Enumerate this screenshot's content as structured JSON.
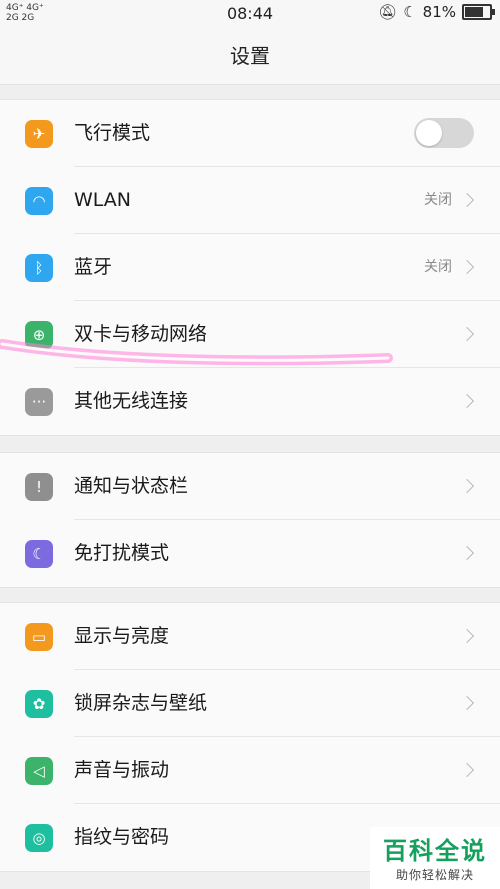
{
  "status_bar": {
    "signal_line1": "4G⁺ 4G⁺",
    "signal_line2": "2G  2G",
    "time": "08:44",
    "battery": "81%",
    "battery_level": 0.81
  },
  "header": {
    "title": "设置"
  },
  "groups": [
    {
      "items": [
        {
          "label": "飞行模式",
          "icon": "airplane-icon",
          "icon_color": "#f39a1e",
          "control": "toggle",
          "toggle_on": false
        },
        {
          "label": "WLAN",
          "icon": "wifi-icon",
          "icon_color": "#2ea7f0",
          "value": "关闭"
        },
        {
          "label": "蓝牙",
          "icon": "bluetooth-icon",
          "icon_color": "#2ea7f0",
          "value": "关闭"
        },
        {
          "label": "双卡与移动网络",
          "icon": "globe-icon",
          "icon_color": "#3bb36b"
        },
        {
          "label": "其他无线连接",
          "icon": "more-dots-icon",
          "icon_color": "#9a9a9a"
        }
      ]
    },
    {
      "items": [
        {
          "label": "通知与状态栏",
          "icon": "exclamation-icon",
          "icon_color": "#8f8f8f"
        },
        {
          "label": "免打扰模式",
          "icon": "moon-icon",
          "icon_color": "#7b6ae0"
        }
      ]
    },
    {
      "items": [
        {
          "label": "显示与亮度",
          "icon": "display-icon",
          "icon_color": "#f39a1e"
        },
        {
          "label": "锁屏杂志与壁纸",
          "icon": "flower-icon",
          "icon_color": "#1dbf9e"
        },
        {
          "label": "声音与振动",
          "icon": "speaker-icon",
          "icon_color": "#3bb36b"
        },
        {
          "label": "指纹与密码",
          "icon": "fingerprint-icon",
          "icon_color": "#1dbf9e"
        }
      ]
    }
  ],
  "watermark": {
    "title": "百科全说",
    "subtitle": "助你轻松解决"
  }
}
